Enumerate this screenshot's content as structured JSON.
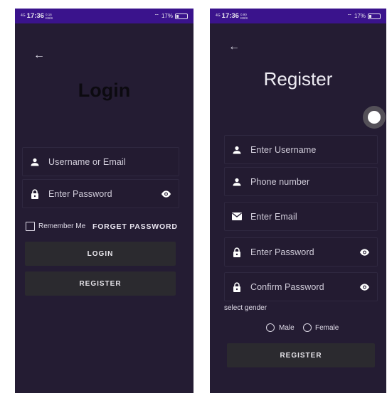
{
  "login_screen": {
    "status": {
      "network": "4G",
      "time": "17:36",
      "speed": "0.16 KB/S",
      "battery": "17%"
    },
    "title": "Login",
    "username_placeholder": "Username or Email",
    "password_placeholder": "Enter Password",
    "remember_label": "Remember Me",
    "forget_label": "FORGET PASSWORD",
    "login_button": "LOGIN",
    "register_button": "REGISTER"
  },
  "register_screen": {
    "status": {
      "network": "4G",
      "time": "17:36",
      "speed": "0.90 KB/S",
      "battery": "17%"
    },
    "title": "Register",
    "username_placeholder": "Enter Username",
    "phone_placeholder": "Phone number",
    "email_placeholder": "Enter Email",
    "password_placeholder": "Enter Password",
    "confirm_placeholder": "Confirm Password",
    "gender_label": "select gender",
    "gender_options": [
      "Male",
      "Female"
    ],
    "register_button": "REGISTER"
  },
  "icons": {
    "back": "arrow-left-icon",
    "person": "person-icon",
    "lock": "lock-icon",
    "eye": "eye-icon",
    "mail": "mail-icon"
  },
  "colors": {
    "background": "#241c33",
    "status_bar": "#3a138c",
    "button": "#2b2a2f",
    "text": "#d2cedb"
  }
}
